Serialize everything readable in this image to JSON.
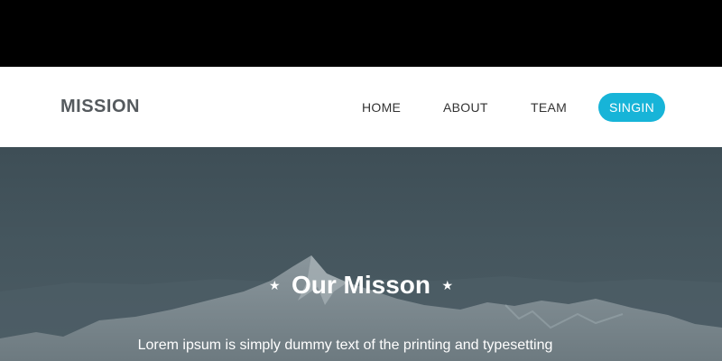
{
  "header": {
    "brand": "MISSION",
    "nav": {
      "home": "HOME",
      "about": "ABOUT",
      "team": "TEAM"
    },
    "signin_label": "SINGIN"
  },
  "hero": {
    "title": "Our Misson",
    "title_decoration_icon": "star-icon",
    "subtitle": "Lorem ipsum is simply dummy text of the printing and typesetting"
  },
  "colors": {
    "signin_button": "#17b4d8",
    "brand_text": "#555a5e",
    "hero_overlay": "#45565e",
    "navbar_bg": "#ffffff"
  }
}
